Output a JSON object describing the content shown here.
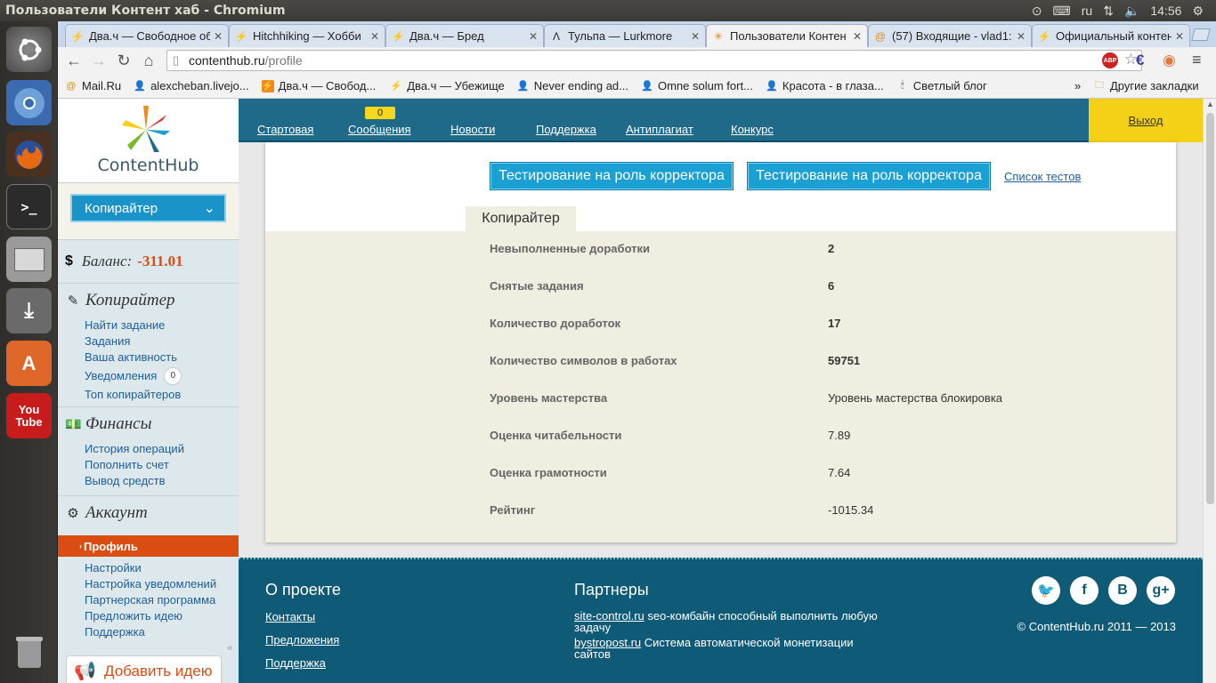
{
  "window": {
    "title": "Пользователи Контент хаб - Chromium"
  },
  "panel": {
    "lang": "ru",
    "time": "14:56"
  },
  "tabs": [
    {
      "label": "Два.ч — Свободное об",
      "icon": "bolt-icon",
      "active": false
    },
    {
      "label": "Hitchhiking — Хобби",
      "icon": "bolt-icon",
      "active": false
    },
    {
      "label": "Два.ч — Бред",
      "icon": "bolt-icon",
      "active": false
    },
    {
      "label": "Тульпа — Lurkmore",
      "icon": "lambda-icon",
      "active": false
    },
    {
      "label": "Пользователи Контен",
      "icon": "contenthub-icon",
      "active": true
    },
    {
      "label": "(57) Входящие - vlad1:",
      "icon": "mail-icon",
      "active": false
    },
    {
      "label": "Официальный контент",
      "icon": "bolt-icon",
      "active": false
    }
  ],
  "address": {
    "host": "contenthub.ru",
    "path": "/profile"
  },
  "bookmarks": [
    {
      "label": "Mail.Ru",
      "icon": "mailru-icon"
    },
    {
      "label": "alexcheban.livejo...",
      "icon": "user-icon"
    },
    {
      "label": "Два.ч — Свобод...",
      "icon": "bolt-icon"
    },
    {
      "label": "Два.ч — Убежище",
      "icon": "bolt-icon"
    },
    {
      "label": "Never ending ad...",
      "icon": "user-icon"
    },
    {
      "label": "Omne solum fort...",
      "icon": "user-icon"
    },
    {
      "label": "Красота - в глаза...",
      "icon": "user-icon"
    },
    {
      "label": "Светлый блог",
      "icon": "user-icon"
    }
  ],
  "bookmarks_more": "»",
  "bookmarks_other": "Другие закладки",
  "sidebar": {
    "logo_text": "ContentHub",
    "role": "Копирайтер",
    "balance_label": "Баланс:",
    "balance_value": "-311.01",
    "copywriter": {
      "title": "Копирайтер",
      "items": [
        "Найти задание",
        "Задания",
        "Ваша активность",
        "Уведомления",
        "Топ копирайтеров"
      ],
      "notifications_count": "0"
    },
    "finance": {
      "title": "Финансы",
      "items": [
        "История операций",
        "Пополнить счет",
        "Вывод средств"
      ]
    },
    "account": {
      "title": "Аккаунт",
      "active": "Профиль",
      "items": [
        "Настройки",
        "Настройка уведомлений",
        "Партнерская программа",
        "Предложить идею",
        "Поддержка"
      ]
    },
    "add_idea": "Добавить идею"
  },
  "nav": {
    "items": [
      "Стартовая",
      "Сообщения",
      "Новости",
      "Поддержка",
      "Антиплагиат",
      "Конкурс"
    ],
    "messages_count": "0",
    "exit": "Выход"
  },
  "main": {
    "test_buttons": [
      "Тестирование на роль корректора",
      "Тестирование на роль корректора"
    ],
    "test_list": "Список тестов",
    "role_tab": "Копирайтер",
    "stats": [
      {
        "label": "Невыполненные доработки",
        "value": "2"
      },
      {
        "label": "Снятые задания",
        "value": "6"
      },
      {
        "label": "Количество доработок",
        "value": "17"
      },
      {
        "label": "Количество символов в работах",
        "value": "59751"
      },
      {
        "label": "Уровень мастерства",
        "value": "Уровень мастерства блокировка"
      },
      {
        "label": "Оценка читабельности",
        "value": "7.89"
      },
      {
        "label": "Оценка грамотности",
        "value": "7.64"
      },
      {
        "label": "Рейтинг",
        "value": "-1015.34"
      }
    ]
  },
  "footer": {
    "about_title": "О проекте",
    "about_links": [
      "Контакты",
      "Предложения",
      "Поддержка"
    ],
    "partners_title": "Партнеры",
    "partners": [
      {
        "link": "site-control.ru",
        "text": " seo-комбайн способный выполнить любую задачу"
      },
      {
        "link": "bystropost.ru",
        "text": " Система автоматической монетизации сайтов"
      }
    ],
    "social": [
      "twitter-icon",
      "facebook-icon",
      "vk-icon",
      "googleplus-icon"
    ],
    "copyright": "© ContentHub.ru 2011 — 2013"
  },
  "colors": {
    "accent": "#1e6a88",
    "orange": "#d94d12",
    "yellow": "#f4d116",
    "button": "#1aa0d2"
  }
}
